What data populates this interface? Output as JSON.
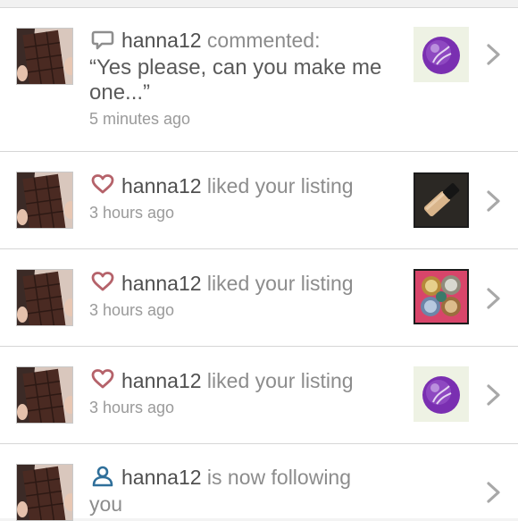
{
  "notifications": [
    {
      "user": "hanna12",
      "action": " commented:",
      "quote": "“Yes please, can you make me one...”",
      "time": "5 minutes ago",
      "icon": "comment-icon",
      "thumbnail": "purple-compact-thumbnail"
    },
    {
      "user": "hanna12",
      "action": " liked your listing",
      "time": "3 hours ago",
      "icon": "heart-icon",
      "thumbnail": "concealer-tube-thumbnail"
    },
    {
      "user": "hanna12",
      "action": " liked your listing",
      "time": "3 hours ago",
      "icon": "heart-icon",
      "thumbnail": "eyeshadow-pots-thumbnail"
    },
    {
      "user": "hanna12",
      "action": " liked your listing",
      "time": "3 hours ago",
      "icon": "heart-icon",
      "thumbnail": "purple-compact-thumbnail"
    },
    {
      "user": "hanna12",
      "action": " is now following",
      "action_line2": "you",
      "icon": "person-icon"
    }
  ],
  "colors": {
    "heart": "#b5626a",
    "comment": "#8e8e8e",
    "follow": "#2f6f9a",
    "chevron": "#a8a8a8",
    "chocolate": "#4a2a22"
  }
}
